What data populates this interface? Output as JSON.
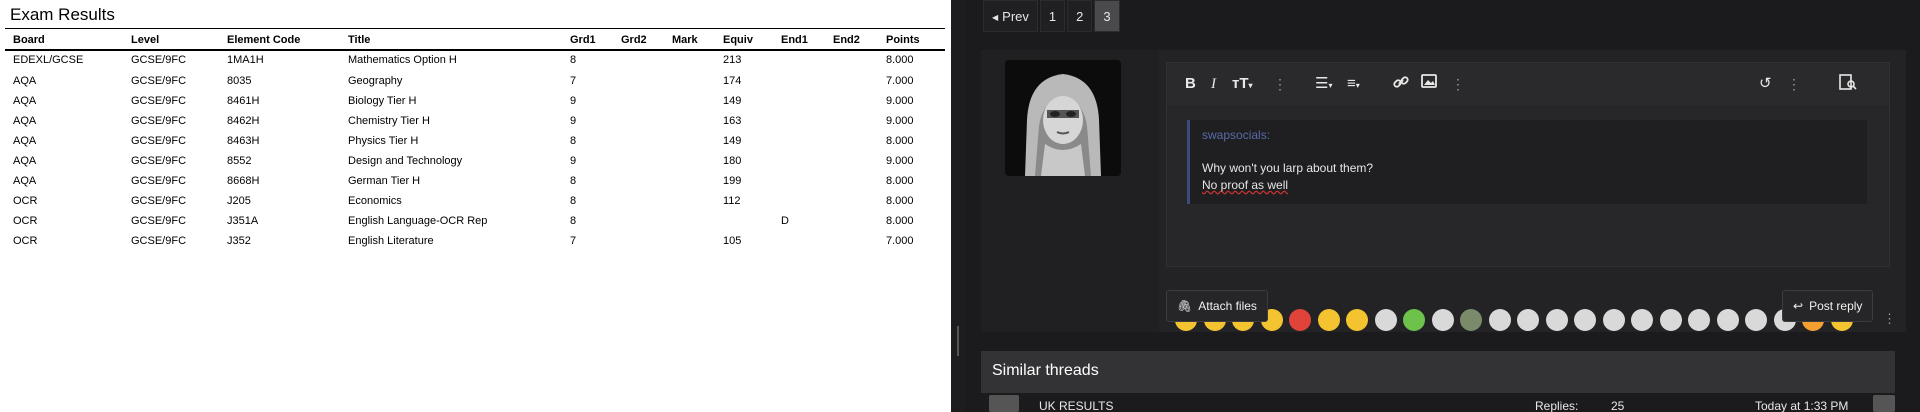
{
  "exam": {
    "title": "Exam Results",
    "headers": [
      "Board",
      "Level",
      "Element Code",
      "Title",
      "Grd1",
      "Grd2",
      "Mark",
      "Equiv",
      "End1",
      "End2",
      "Points"
    ],
    "rows": [
      [
        "EDEXL/GCSE",
        "GCSE/9FC",
        "1MA1H",
        "Mathematics Option H",
        "8",
        "",
        "",
        "213",
        "",
        "",
        "8.000"
      ],
      [
        "AQA",
        "GCSE/9FC",
        "8035",
        "Geography",
        "7",
        "",
        "",
        "174",
        "",
        "",
        "7.000"
      ],
      [
        "AQA",
        "GCSE/9FC",
        "8461H",
        "Biology Tier H",
        "9",
        "",
        "",
        "149",
        "",
        "",
        "9.000"
      ],
      [
        "AQA",
        "GCSE/9FC",
        "8462H",
        "Chemistry Tier H",
        "9",
        "",
        "",
        "163",
        "",
        "",
        "9.000"
      ],
      [
        "AQA",
        "GCSE/9FC",
        "8463H",
        "Physics Tier H",
        "8",
        "",
        "",
        "149",
        "",
        "",
        "8.000"
      ],
      [
        "AQA",
        "GCSE/9FC",
        "8552",
        "Design and Technology",
        "9",
        "",
        "",
        "180",
        "",
        "",
        "9.000"
      ],
      [
        "AQA",
        "GCSE/9FC",
        "8668H",
        "German Tier H",
        "8",
        "",
        "",
        "199",
        "",
        "",
        "8.000"
      ],
      [
        "OCR",
        "GCSE/9FC",
        "J205",
        "Economics",
        "8",
        "",
        "",
        "112",
        "",
        "",
        "8.000"
      ],
      [
        "OCR",
        "GCSE/9FC",
        "J351A",
        "English Language-OCR Rep",
        "8",
        "",
        "",
        "",
        "D",
        "",
        "8.000"
      ],
      [
        "OCR",
        "GCSE/9FC",
        "J352",
        "English Literature",
        "7",
        "",
        "",
        "105",
        "",
        "",
        "7.000"
      ]
    ]
  },
  "pagination": {
    "prev": "Prev",
    "pages": [
      "1",
      "2",
      "3"
    ],
    "current": "3"
  },
  "editor": {
    "toolbar_icons": [
      "bold-icon",
      "italic-icon",
      "text-size-icon",
      "more-options-icon",
      "list-icon",
      "align-icon",
      "link-icon",
      "image-icon",
      "more-options-icon",
      "undo-icon",
      "more-options-icon",
      "preview-icon"
    ],
    "quote_author": "swapsocials:",
    "lines": [
      "Why won't you larp about them?",
      "No proof as well"
    ],
    "emojis": [
      "smiley-icon",
      "rofl-icon",
      "heart-eyes-icon",
      "confused-icon",
      "angry-icon",
      "grin-icon",
      "joy-icon",
      "face-icon",
      "sick-icon",
      "face-icon",
      "picture-icon",
      "face-icon",
      "face-icon",
      "face-icon",
      "face-icon",
      "face-icon",
      "face-icon",
      "face-icon",
      "face-icon",
      "face-icon",
      "pill-icon",
      "pill-icon",
      "blush-icon",
      "smile-icon"
    ]
  },
  "actions": {
    "attach": "Attach files",
    "post": "Post reply"
  },
  "similar": {
    "title": "Similar threads",
    "threads": [
      {
        "title": "UK RESULTS",
        "replies_label": "Replies:",
        "replies": "25",
        "time": "Today at 1:33 PM"
      }
    ]
  },
  "colors": {
    "panel_bg": "#1b1b1d",
    "accent_quote": "#5a6aa8",
    "section_header": "#333335"
  }
}
